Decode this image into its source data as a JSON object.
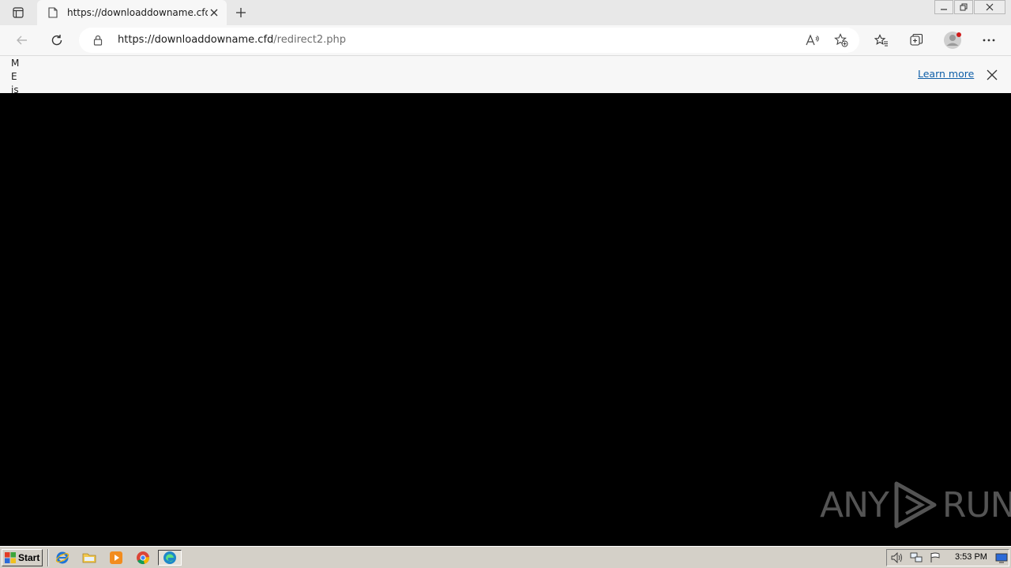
{
  "browser": {
    "tab": {
      "title": "https://downloaddowname.cfd/r"
    },
    "address": {
      "host": "https://downloaddowname.cfd",
      "path": "/redirect2.php"
    }
  },
  "notice": {
    "fragment_lines": [
      "M",
      "E",
      "is"
    ],
    "learn_more": "Learn more"
  },
  "watermark": {
    "left": "ANY",
    "right": "RUN"
  },
  "taskbar": {
    "start_label": "Start",
    "clock": "3:53 PM"
  },
  "colors": {
    "page_background": "#000000",
    "link": "#0f5fa8",
    "taskbar": "#d4d0c8"
  }
}
